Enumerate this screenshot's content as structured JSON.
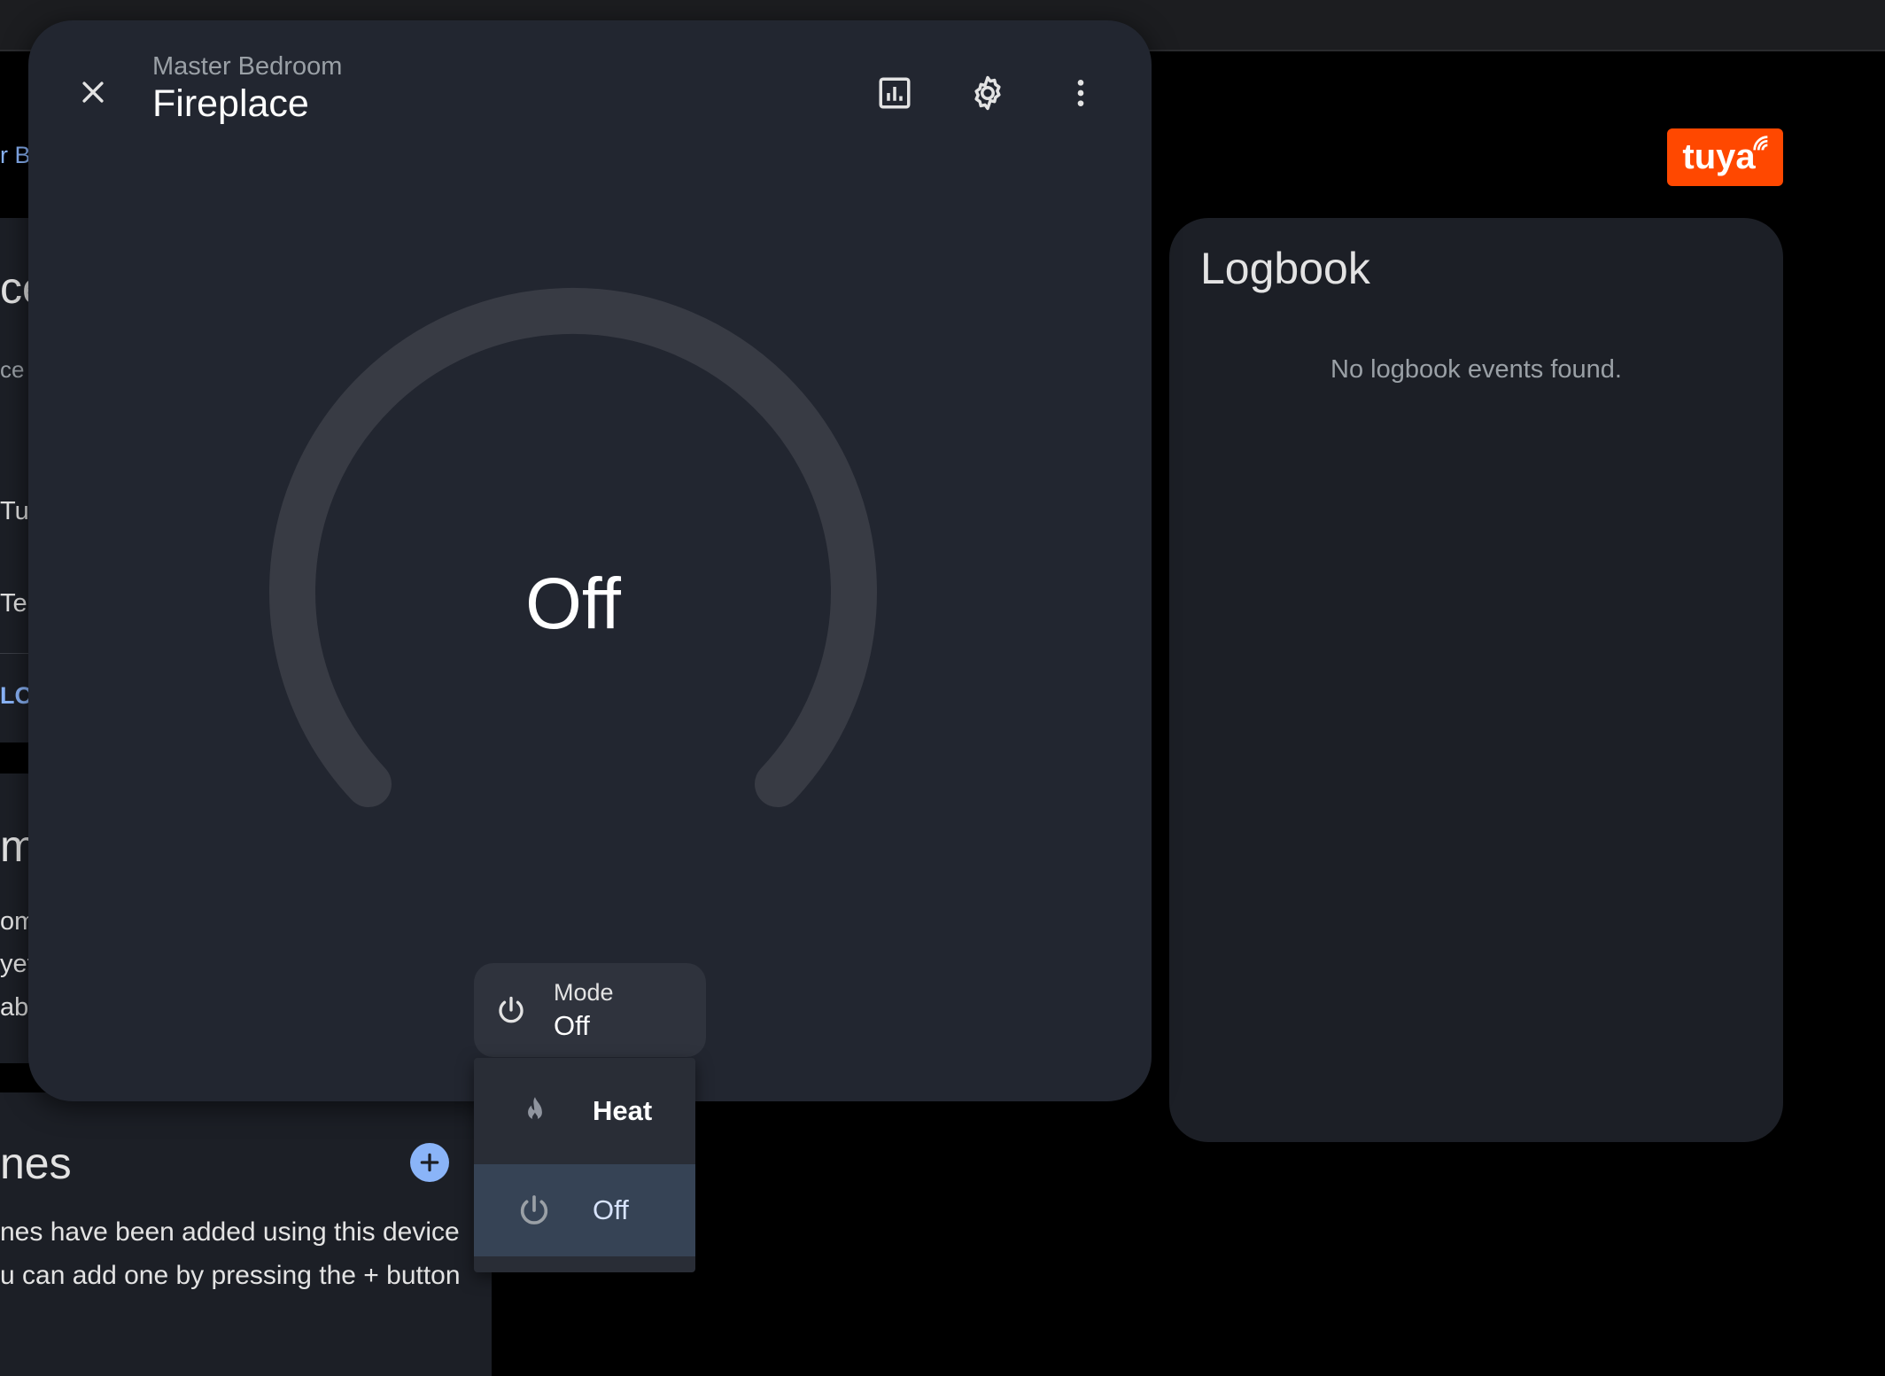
{
  "dialog": {
    "subtitle": "Master Bedroom",
    "title": "Fireplace",
    "gauge_state": "Off"
  },
  "mode_control": {
    "label": "Mode",
    "value": "Off"
  },
  "mode_menu": {
    "options": [
      {
        "label": "Heat",
        "icon": "fire-icon",
        "selected": false
      },
      {
        "label": "Off",
        "icon": "power-icon",
        "selected": true
      }
    ]
  },
  "logbook": {
    "title": "Logbook",
    "empty_text": "No logbook events found."
  },
  "background": {
    "fragment_1": "r B",
    "fragment_2": "ce",
    "fragment_3": "ce (",
    "fragment_4": "Tu",
    "fragment_5": "Te",
    "fragment_6": "LO",
    "fragment_7": "m",
    "fragment_8": "om",
    "fragment_9": "yet",
    "fragment_10": "abo",
    "scenes_title": "nes",
    "scenes_text_line1": "nes have been added using this device",
    "scenes_text_line2": "u can add one by pressing the + button"
  },
  "brand": {
    "logo_text": "tuya",
    "color": "#ff4800"
  },
  "colors": {
    "page_bg": "#000000",
    "dialog_bg": "#222630",
    "card_bg": "#1c1f26",
    "gauge_track": "#383b44",
    "accent_blue": "#8ab4f8",
    "selected_item_bg": "#364355"
  }
}
